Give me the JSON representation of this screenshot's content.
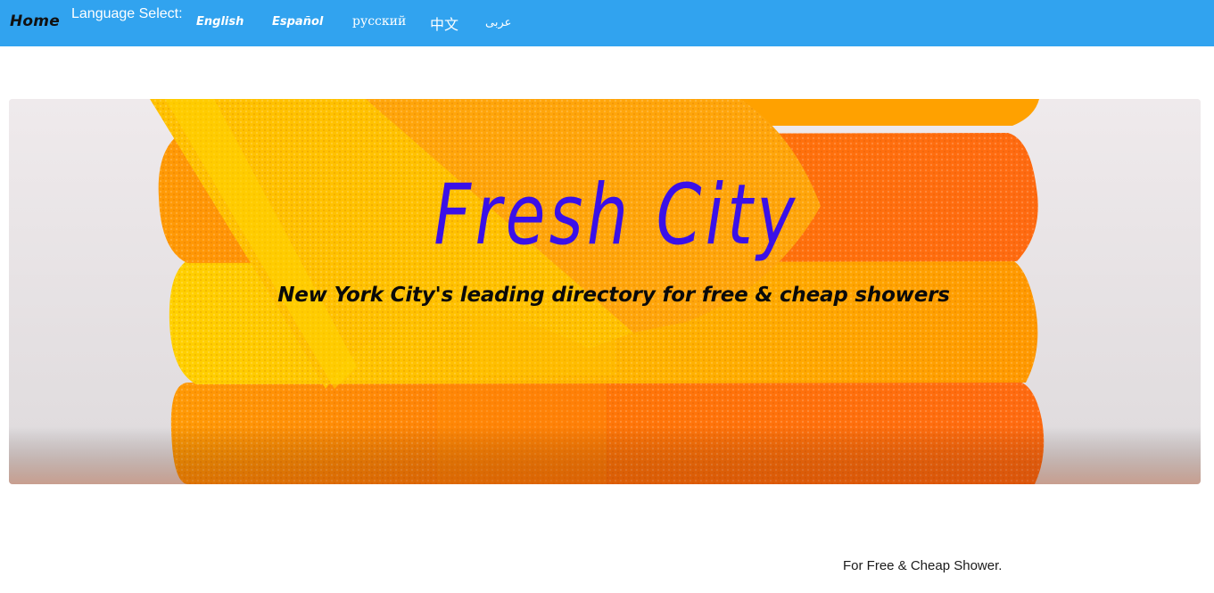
{
  "nav": {
    "home": "Home",
    "language_label": "Language Select:",
    "languages": [
      "English",
      "Español",
      "русский",
      "中文",
      "عربى"
    ]
  },
  "hero": {
    "title": "Fresh City",
    "subtitle": "New York City's leading directory for free & cheap showers",
    "image": "stacked-orange-towels-photo"
  },
  "footer": {
    "tagline": "For Free & Cheap Shower."
  },
  "colors": {
    "navbar": "#31a3ef",
    "title": "#3a10e8",
    "towel_orange": "#ff7a0a",
    "towel_yellow": "#ffb400"
  }
}
